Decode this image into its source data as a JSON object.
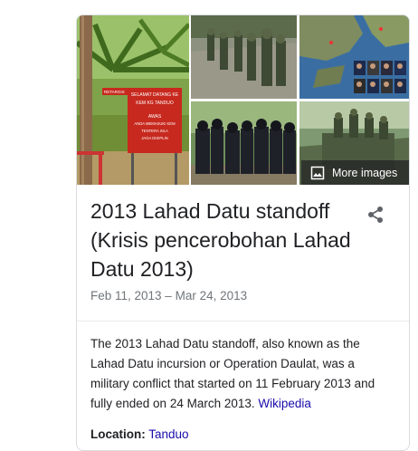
{
  "knowledge_panel": {
    "more_images_label": "More images",
    "title": "2013 Lahad Datu standoff (Krisis pencerobohan Lahad Datu 2013)",
    "dates": "Feb 11, 2013 – Mar 24, 2013",
    "description": "The 2013 Lahad Datu standoff, also known as the Lahad Datu incursion or Operation Daulat, was a military conflict that started on 11 February 2013 and fully ended on 24 March 2013.",
    "source_link": "Wikipedia",
    "location_label": "Location:",
    "location_value": "Tanduo",
    "sign_text": {
      "line1": "RETARGIS",
      "line2": "SELAMAT DATANG KE",
      "line3": "KEM KG TANDUO",
      "line4": "AWAS",
      "line5": "ANDA MEMASUKI KEM",
      "line6": "TENTERA SILA",
      "line7": "JAGA DISIPLIN"
    }
  },
  "colors": {
    "link": "#1a0dab",
    "text": "#202124",
    "muted": "#70757a",
    "border": "#dadce0"
  }
}
